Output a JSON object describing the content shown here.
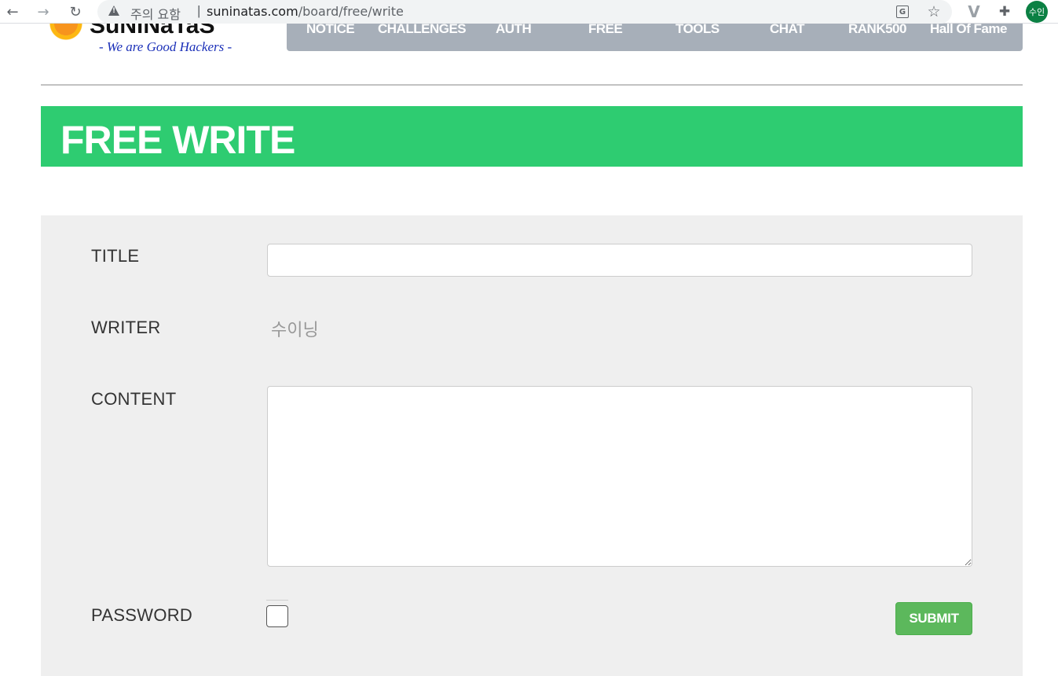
{
  "browser": {
    "back_glyph": "←",
    "forward_glyph": "→",
    "reload_glyph": "↻",
    "security_label": "주의 요함",
    "url_host": "suninatas.com",
    "url_path": "/board/free/write",
    "translate_glyph": "G",
    "star_glyph": "☆",
    "extension_v_glyph": "V",
    "puzzle_glyph": "✚",
    "profile_initials": "수인",
    "profile_color": "#0b8043"
  },
  "site": {
    "logo_name": "SuNiNaTaS",
    "logo_tagline": "- We are Good Hackers -",
    "nav": [
      {
        "label": "NOTICE"
      },
      {
        "label": "CHALLENGES"
      },
      {
        "label": "AUTH"
      },
      {
        "label": "FREE"
      },
      {
        "label": "TOOLS"
      },
      {
        "label": "CHAT"
      },
      {
        "label": "RANK500"
      },
      {
        "label": "Hall Of Fame"
      }
    ],
    "nav_color": "#a7afb9"
  },
  "page": {
    "banner_title": "FREE WRITE",
    "banner_color": "#2ecc71"
  },
  "form": {
    "title_label": "TITLE",
    "title_value": "",
    "writer_label": "WRITER",
    "writer_value": "수이닝",
    "content_label": "CONTENT",
    "content_value": "",
    "password_label": "PASSWORD",
    "password_value": "",
    "submit_label": "SUBMIT",
    "submit_color": "#5cb85c"
  }
}
